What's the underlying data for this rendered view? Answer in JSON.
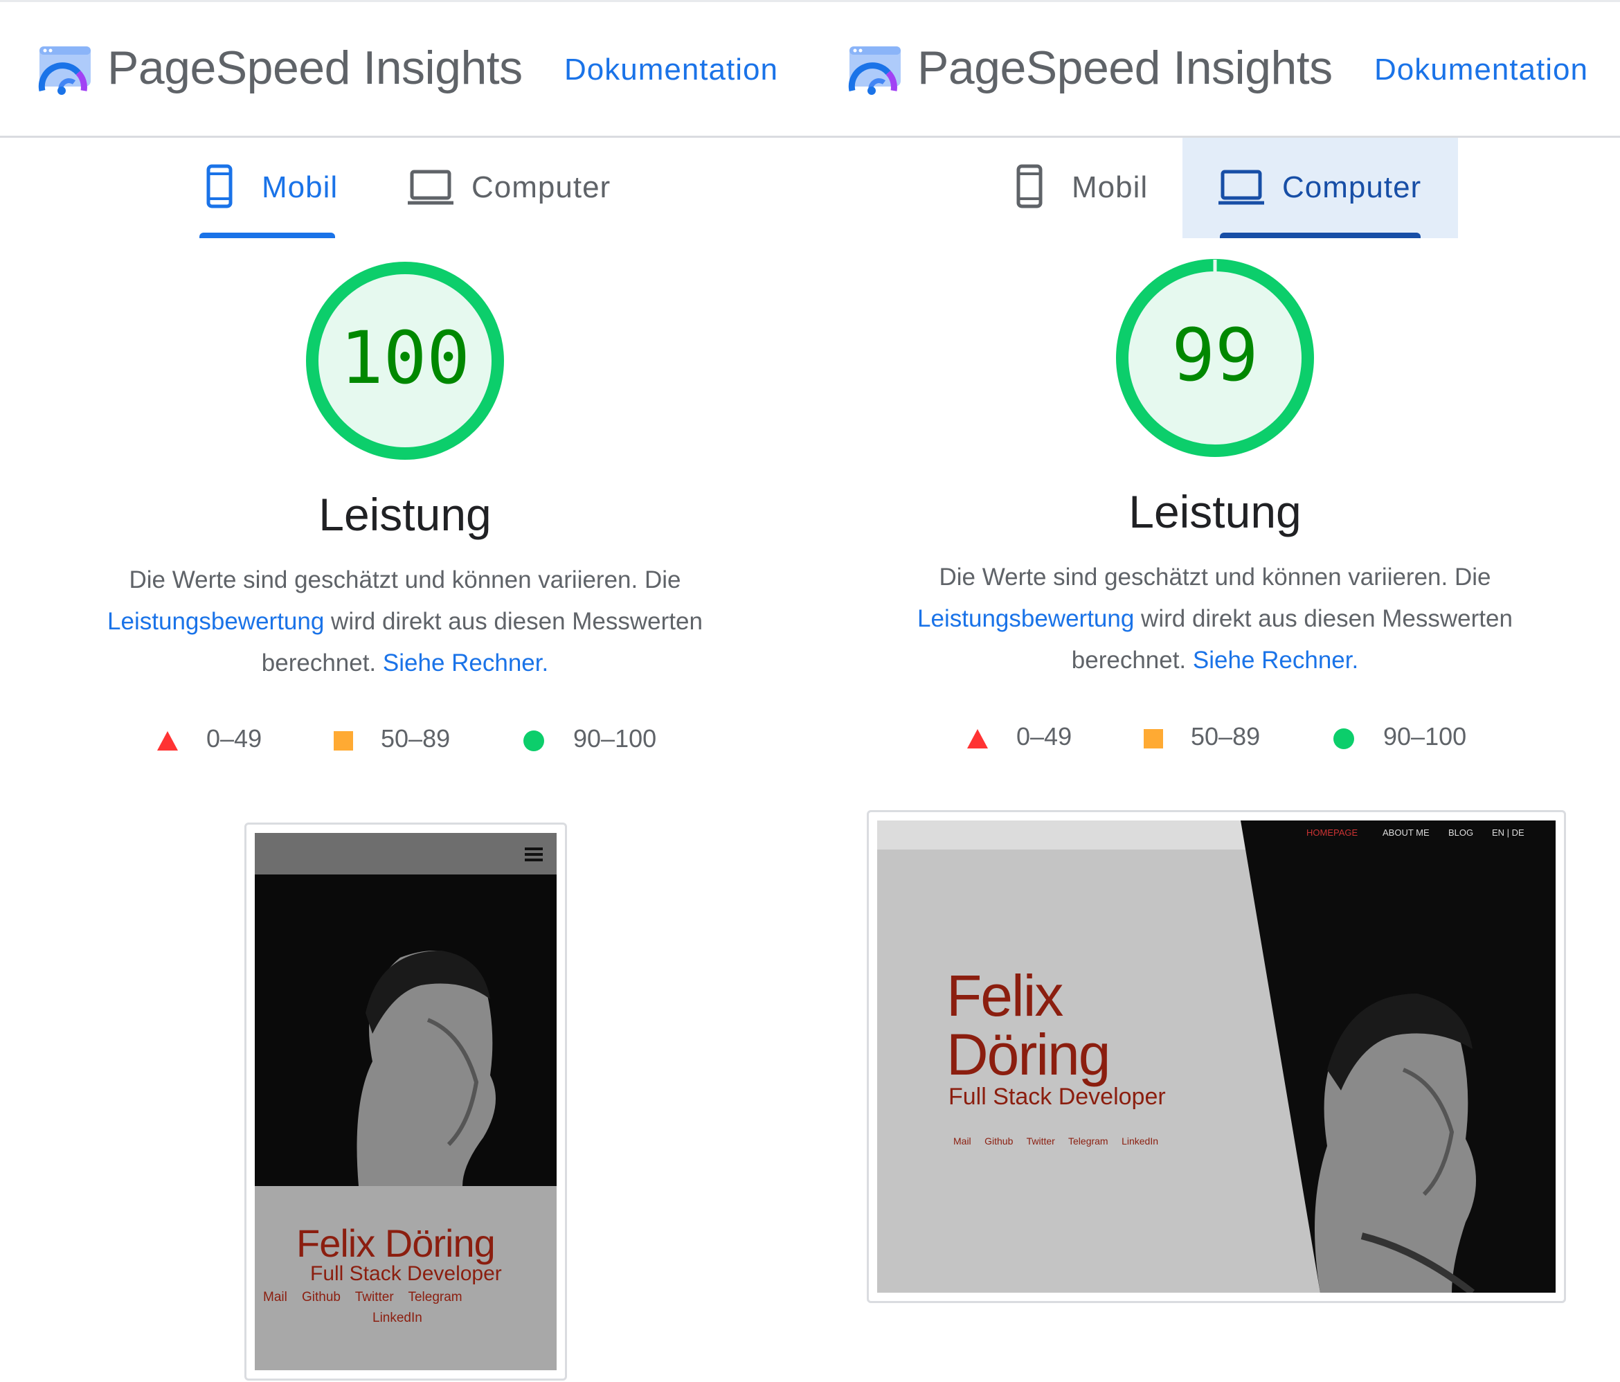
{
  "panels": [
    {
      "app_title": "PageSpeed Insights",
      "doc_link": "Dokumentation",
      "tabs": [
        {
          "label": "Mobil",
          "active": true
        },
        {
          "label": "Computer",
          "active": false
        }
      ],
      "score": "100",
      "metric": "Leistung",
      "description": {
        "part1": "Die Werte sind geschätzt und können variieren. Die ",
        "link1": "Leistungsbewertung",
        "part2": " wird direkt aus diesen Messwerten berechnet. ",
        "link2": "Siehe Rechner."
      },
      "legend": [
        {
          "range": "0–49",
          "shape": "triangle",
          "color": "#ff3333"
        },
        {
          "range": "50–89",
          "shape": "square",
          "color": "#ffaa33"
        },
        {
          "range": "90–100",
          "shape": "circle",
          "color": "#0cce6b"
        }
      ],
      "screenshot": {
        "name": "Felix Döring",
        "role": "Full Stack Developer",
        "links": [
          "Mail",
          "Github",
          "Twitter",
          "Telegram",
          "LinkedIn"
        ]
      }
    },
    {
      "app_title": "PageSpeed Insights",
      "doc_link": "Dokumentation",
      "tabs": [
        {
          "label": "Mobil",
          "active": false
        },
        {
          "label": "Computer",
          "active": true
        }
      ],
      "score": "99",
      "metric": "Leistung",
      "description": {
        "part1": "Die Werte sind geschätzt und können variieren. Die ",
        "link1": "Leistungsbewertung",
        "part2": " wird direkt aus diesen Messwerten berechnet. ",
        "link2": "Siehe Rechner."
      },
      "legend": [
        {
          "range": "0–49",
          "shape": "triangle",
          "color": "#ff3333"
        },
        {
          "range": "50–89",
          "shape": "square",
          "color": "#ffaa33"
        },
        {
          "range": "90–100",
          "shape": "circle",
          "color": "#0cce6b"
        }
      ],
      "screenshot": {
        "name_line1": "Felix",
        "name_line2": "Döring",
        "role": "Full Stack Developer",
        "nav": [
          "HOMEPAGE",
          "ABOUT ME",
          "BLOG",
          "EN | DE"
        ],
        "links": [
          "Mail",
          "Github",
          "Twitter",
          "Telegram",
          "LinkedIn"
        ]
      }
    }
  ],
  "colors": {
    "accent": "#1a73e8",
    "pass_green": "#0cce6b",
    "score_text": "#008800",
    "gauge_fill": "#e6f9ef",
    "site_red": "#8b1e0f",
    "active_tab_bg": "#e3edf9"
  },
  "icons": [
    "pagespeed-logo-icon",
    "phone-icon",
    "laptop-icon",
    "hamburger-menu-icon"
  ]
}
